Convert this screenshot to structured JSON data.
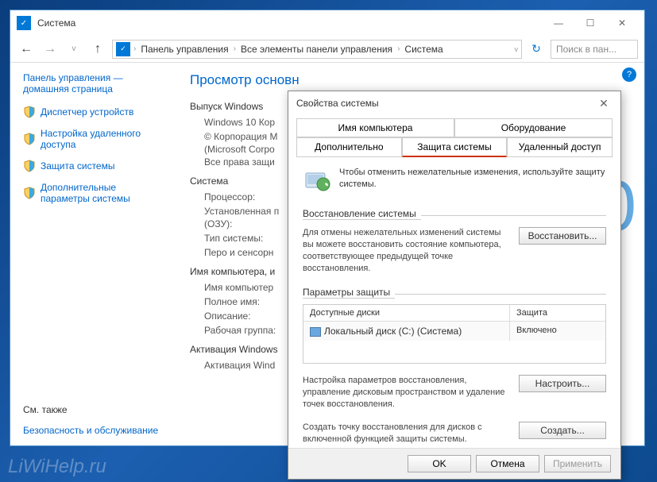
{
  "window": {
    "title": "Система",
    "breadcrumbs": [
      "Панель управления",
      "Все элементы панели управления",
      "Система"
    ],
    "search_placeholder": "Поиск в пан..."
  },
  "sidebar": {
    "home": "Панель управления — домашняя страница",
    "links": [
      "Диспетчер устройств",
      "Настройка удаленного доступа",
      "Защита системы",
      "Дополнительные параметры системы"
    ],
    "see_also": "См. также",
    "security": "Безопасность и обслуживание"
  },
  "main": {
    "title": "Просмотр основн",
    "s1": "Выпуск Windows",
    "s1_v1": "Windows 10 Кор",
    "s1_v2": "© Корпорация М",
    "s1_v3": "(Microsoft Corpo",
    "s1_v4": "Все права защи",
    "s2": "Система",
    "s2_f1": "Процессор:",
    "s2_f2": "Установленная п",
    "s2_f2b": "(ОЗУ):",
    "s2_f3": "Тип системы:",
    "s2_f4": "Перо и сенсорн",
    "s3": "Имя компьютера, и",
    "s3_f1": "Имя компьютер",
    "s3_f2": "Полное имя:",
    "s3_f3": "Описание:",
    "s3_f4": "Рабочая группа:",
    "s4": "Активация Windows",
    "s4_f1": "Активация Wind"
  },
  "dialog": {
    "title": "Свойства системы",
    "tabs_top": [
      "Имя компьютера",
      "Оборудование"
    ],
    "tabs_bottom": [
      "Дополнительно",
      "Защита системы",
      "Удаленный доступ"
    ],
    "intro": "Чтобы отменить нежелательные изменения, используйте защиту системы.",
    "restore_head": "Восстановление системы",
    "restore_text": "Для отмены нежелательных изменений системы вы можете восстановить состояние компьютера, соответствующее предыдущей точке восстановления.",
    "restore_btn": "Восстановить...",
    "params_head": "Параметры защиты",
    "col1": "Доступные диски",
    "col2": "Защита",
    "drive_name": "Локальный диск (C:) (Система)",
    "drive_status": "Включено",
    "configure_text": "Настройка параметров восстановления, управление дисковым пространством и удаление точек восстановления.",
    "configure_btn": "Настроить...",
    "create_text": "Создать точку восстановления для дисков с включенной функцией защиты системы.",
    "create_btn": "Создать...",
    "ok": "OK",
    "cancel": "Отмена",
    "apply": "Применить"
  }
}
